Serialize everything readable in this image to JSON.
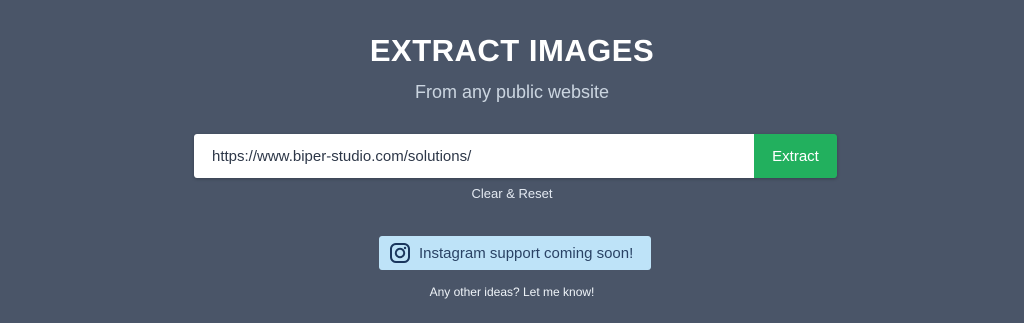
{
  "hero": {
    "title": "EXTRACT IMAGES",
    "subtitle": "From any public website"
  },
  "search": {
    "value": "https://www.biper-studio.com/solutions/",
    "button_label": "Extract"
  },
  "reset": {
    "label": "Clear & Reset"
  },
  "notice": {
    "icon": "instagram-icon",
    "text": "Instagram support coming soon!"
  },
  "footer": {
    "ideas_label": "Any other ideas? Let me know!"
  },
  "colors": {
    "background": "#4a5568",
    "accent": "#22b05e",
    "notice_bg": "#bee3f8",
    "notice_text": "#2a4365"
  }
}
